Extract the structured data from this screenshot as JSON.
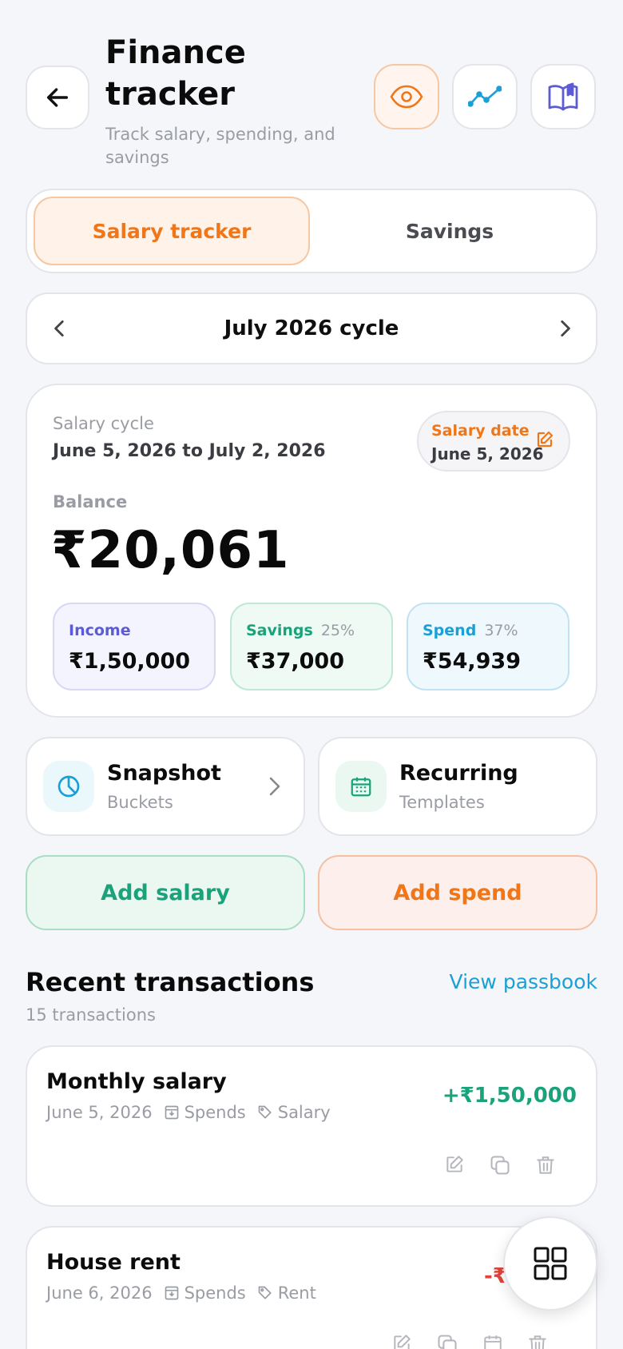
{
  "header": {
    "title": "Finance tracker",
    "subtitle": "Track salary, spending, and savings",
    "back_icon": "arrow-left-icon",
    "action_icons": [
      "eye-icon",
      "trend-line-icon",
      "book-open-icon"
    ]
  },
  "tabs": [
    {
      "label": "Salary tracker",
      "active": true
    },
    {
      "label": "Savings",
      "active": false
    }
  ],
  "cycle_nav": {
    "label": "July 2026 cycle"
  },
  "salary_card": {
    "cycle_label": "Salary cycle",
    "cycle_range": "June 5, 2026 to July 2, 2026",
    "salary_date_label": "Salary date",
    "salary_date_value": "June 5, 2026",
    "balance_label": "Balance",
    "balance_value": "₹20,061",
    "stats": [
      {
        "label": "Income",
        "percent": "",
        "value": "₹1,50,000",
        "color": "#5b5bd6"
      },
      {
        "label": "Savings",
        "percent": "25%",
        "value": "₹37,000",
        "color": "#1aa37a"
      },
      {
        "label": "Spend",
        "percent": "37%",
        "value": "₹54,939",
        "color": "#1a9fd6"
      }
    ]
  },
  "shortcuts": [
    {
      "title": "Snapshot",
      "subtitle": "Buckets",
      "icon": "pie-chart-icon"
    },
    {
      "title": "Recurring",
      "subtitle": "Templates",
      "icon": "calendar-icon"
    }
  ],
  "actions": {
    "add_salary": "Add salary",
    "add_spend": "Add spend"
  },
  "recent": {
    "title": "Recent transactions",
    "count": "15 transactions",
    "view_all": "View passbook",
    "items": [
      {
        "name": "Monthly salary",
        "date": "June 5, 2026",
        "bucket": "Spends",
        "tag": "Salary",
        "amount": "+₹1,50,000",
        "amount_color": "#1aa37a"
      },
      {
        "name": "House rent",
        "date": "June 6, 2026",
        "bucket": "Spends",
        "tag": "Rent",
        "amount": "-₹",
        "amount_color": "#e0443c"
      }
    ]
  },
  "fab": {
    "icon": "grid-icon"
  },
  "colors": {
    "accent_orange": "#f07618",
    "accent_green": "#1aa37a",
    "accent_blue": "#1a9fd6",
    "accent_purple": "#5b5bd6"
  }
}
